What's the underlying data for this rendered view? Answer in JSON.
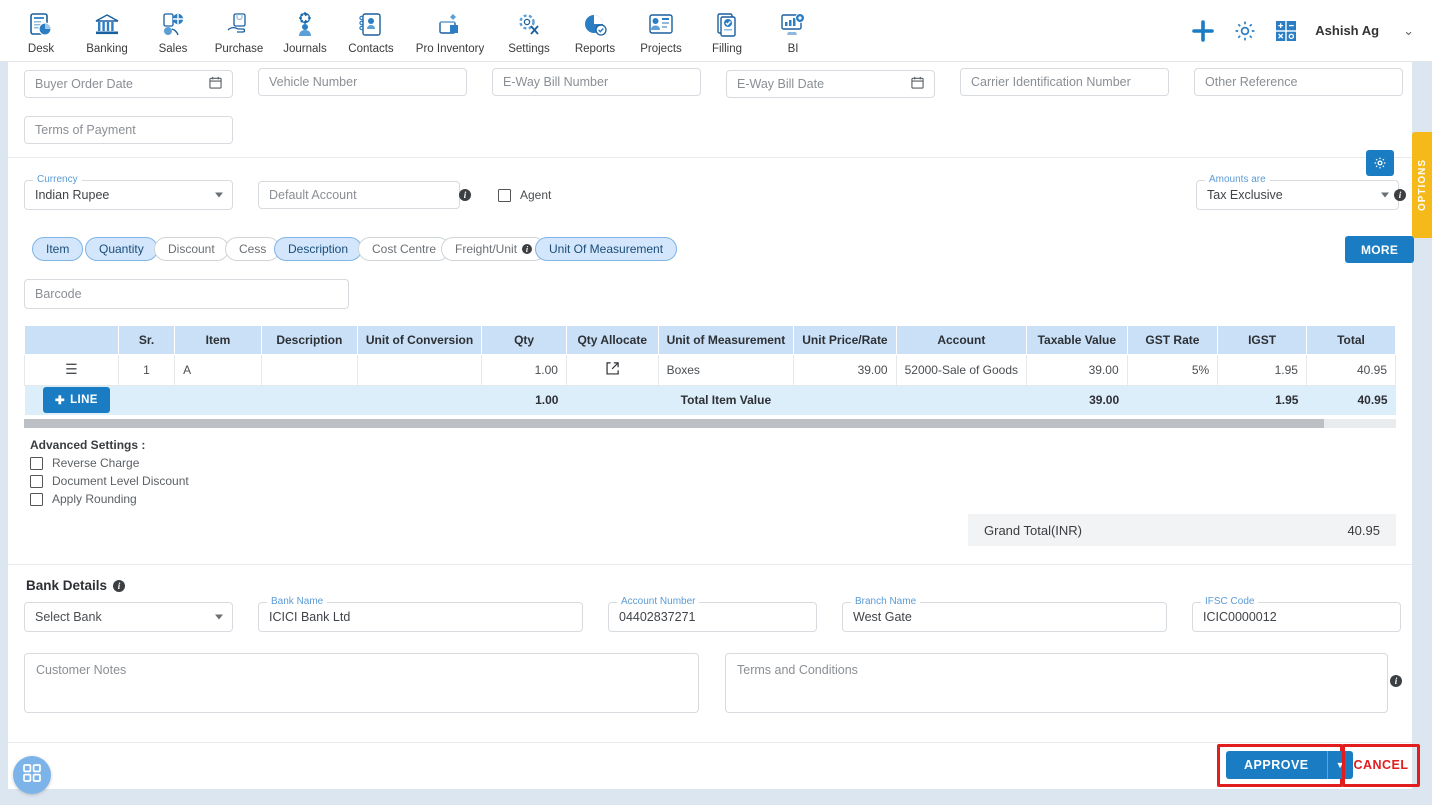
{
  "nav": {
    "items": [
      {
        "label": "Desk",
        "icon": "dashboard-icon"
      },
      {
        "label": "Banking",
        "icon": "bank-icon"
      },
      {
        "label": "Sales",
        "icon": "sales-icon"
      },
      {
        "label": "Purchase",
        "icon": "purchase-icon"
      },
      {
        "label": "Journals",
        "icon": "journals-icon"
      },
      {
        "label": "Contacts",
        "icon": "contacts-icon"
      },
      {
        "label": "Pro Inventory",
        "icon": "inventory-icon"
      },
      {
        "label": "Settings",
        "icon": "settings-tools-icon"
      },
      {
        "label": "Reports",
        "icon": "reports-pie-icon"
      },
      {
        "label": "Projects",
        "icon": "projects-icon"
      },
      {
        "label": "Filling",
        "icon": "filling-icon"
      },
      {
        "label": "BI",
        "icon": "bi-icon"
      }
    ],
    "add_icon": "plus-icon",
    "settings_icon": "gear-icon",
    "calculator_icon": "calculator-icon",
    "user_name": "Ashish Ag",
    "user_caret": "chevron-down-icon"
  },
  "options_tab": {
    "label": "OPTIONS"
  },
  "form": {
    "buyer_order_date": {
      "placeholder": "Buyer Order Date",
      "value": "",
      "icon": "calendar-icon"
    },
    "vehicle_number": {
      "placeholder": "Vehicle Number",
      "value": ""
    },
    "eway_bill_number": {
      "placeholder": "E-Way Bill Number",
      "value": ""
    },
    "eway_bill_date": {
      "placeholder": "E-Way Bill Date",
      "value": "",
      "icon": "calendar-icon"
    },
    "carrier_identification_number": {
      "placeholder": "Carrier Identification Number",
      "value": ""
    },
    "other_reference": {
      "placeholder": "Other Reference",
      "value": ""
    },
    "terms_of_payment": {
      "placeholder": "Terms of Payment",
      "value": ""
    },
    "currency": {
      "label": "Currency",
      "value": "Indian Rupee"
    },
    "default_account": {
      "placeholder": "Default Account",
      "value": ""
    },
    "agent": {
      "label": "Agent",
      "checked": false
    },
    "amounts_are": {
      "label": "Amounts are",
      "value": "Tax Exclusive"
    },
    "settings_gear_icon": "gear-icon"
  },
  "chips": [
    {
      "label": "Item",
      "active": true
    },
    {
      "label": "Quantity",
      "active": true
    },
    {
      "label": "Discount",
      "active": false
    },
    {
      "label": "Cess",
      "active": false
    },
    {
      "label": "Description",
      "active": true
    },
    {
      "label": "Cost Centre",
      "active": false
    },
    {
      "label": "Freight/Unit",
      "active": false,
      "info": true
    },
    {
      "label": "Unit Of Measurement",
      "active": true
    }
  ],
  "more_button": "MORE",
  "barcode": {
    "placeholder": "Barcode",
    "value": ""
  },
  "line_items": {
    "columns": [
      "",
      "Sr.",
      "Item",
      "Description",
      "Unit of Conversion",
      "Qty",
      "Qty Allocate",
      "Unit of Measurement",
      "Unit Price/Rate",
      "Account",
      "Taxable Value",
      "GST Rate",
      "IGST",
      "Total"
    ],
    "rows": [
      {
        "handle": "drag-handle-icon",
        "sr": "1",
        "item": "A",
        "description": "",
        "unit_of_conversion": "",
        "qty": "1.00",
        "qty_allocate": "external-link-icon",
        "unit_of_measurement": "Boxes",
        "unit_price_rate": "39.00",
        "account": "52000-Sale of Goods",
        "taxable_value": "39.00",
        "gst_rate": "5%",
        "igst": "1.95",
        "total": "40.95"
      }
    ],
    "add_line_button": "LINE",
    "totals": {
      "qty": "1.00",
      "label": "Total Item Value",
      "taxable_value": "39.00",
      "igst": "1.95",
      "total": "40.95"
    }
  },
  "advanced_settings": {
    "title": "Advanced Settings :",
    "options": [
      {
        "label": "Reverse Charge",
        "checked": false
      },
      {
        "label": "Document Level Discount",
        "checked": false
      },
      {
        "label": "Apply Rounding",
        "checked": false
      }
    ]
  },
  "grand_total": {
    "label": "Grand Total(INR)",
    "value": "40.95"
  },
  "bank_details": {
    "title": "Bank Details",
    "info_icon": "info-icon",
    "select_bank": {
      "value": "Select Bank"
    },
    "bank_name": {
      "label": "Bank Name",
      "value": "ICICI Bank Ltd"
    },
    "account_number": {
      "label": "Account Number",
      "value": "04402837271"
    },
    "branch_name": {
      "label": "Branch Name",
      "value": "West Gate"
    },
    "ifsc_code": {
      "label": "IFSC Code",
      "value": "ICIC0000012"
    }
  },
  "notes": {
    "customer_notes": {
      "placeholder": "Customer Notes",
      "value": ""
    },
    "terms_and_conditions": {
      "placeholder": "Terms and Conditions",
      "value": ""
    },
    "info_icon": "info-icon"
  },
  "footer": {
    "approve_label": "APPROVE",
    "approve_caret": "chevron-down-icon",
    "cancel_label": "CANCEL",
    "apps_fab_icon": "grid-apps-icon"
  },
  "colors": {
    "accent_blue": "#1a7dc4",
    "chip_active": "#d3e6fb",
    "table_header": "#c9e0f7",
    "totals_row": "#ddeefb",
    "danger_red": "#e11d1d",
    "options_yellow": "#f5b91a",
    "page_bg": "#dce6f0"
  }
}
